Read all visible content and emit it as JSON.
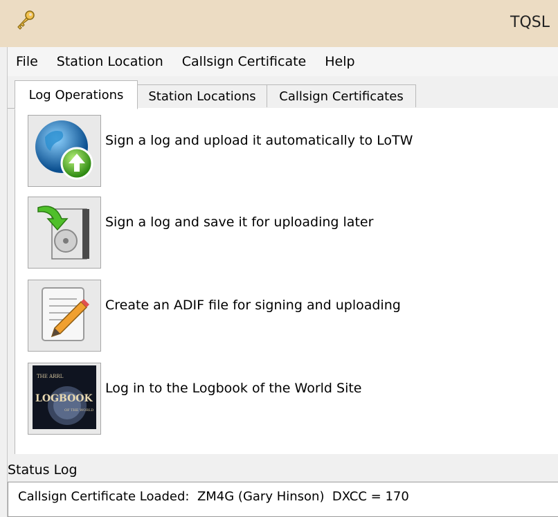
{
  "window": {
    "title": "TQSL",
    "icon": "key-icon"
  },
  "menu": {
    "items": [
      "File",
      "Station Location",
      "Callsign Certificate",
      "Help"
    ]
  },
  "tabs": {
    "items": [
      "Log Operations",
      "Station Locations",
      "Callsign Certificates"
    ],
    "active": "Log Operations"
  },
  "operations": [
    {
      "label": "Sign a log and upload it automatically to LoTW",
      "icon": "globe-upload-icon"
    },
    {
      "label": "Sign a log and save it for uploading later",
      "icon": "save-log-icon"
    },
    {
      "label": "Create an ADIF file for signing and uploading",
      "icon": "edit-document-icon"
    },
    {
      "label": "Log in to the Logbook of the World Site",
      "icon": "logbook-icon"
    }
  ],
  "logbook_icon_text": [
    "THE ARRL",
    "LOGBOOK",
    "OF THE WORLD"
  ],
  "status": {
    "title": "Status Log",
    "line": "Callsign Certificate Loaded:  ZM4G (Gary Hinson)  DXCC = 170"
  }
}
